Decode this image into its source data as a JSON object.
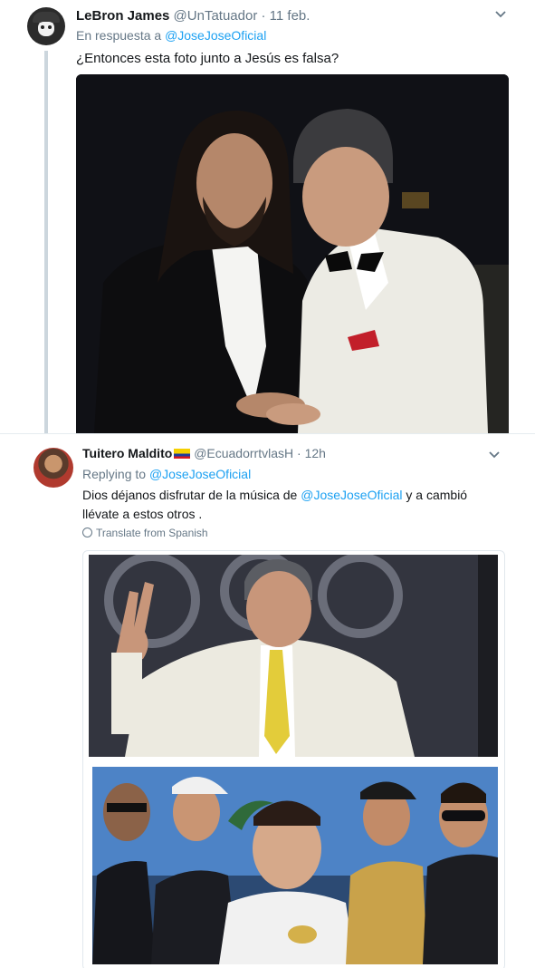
{
  "tweet1": {
    "author_name": "LeBron James",
    "author_handle": "@UnTatuador",
    "date": "11 feb.",
    "reply_prefix": "En respuesta a",
    "reply_to": "@JoseJoseOficial",
    "text": "¿Entonces esta foto junto a Jesús es falsa?"
  },
  "tweet2": {
    "author_name": "Tuitero Maldito",
    "author_handle": "@EcuadorrtvlasH",
    "time": "12h",
    "reply_prefix": "Replying to",
    "reply_to": "@JoseJoseOficial",
    "text_part1": "Dios déjanos disfrutar de la música de",
    "text_mention": "@JoseJoseOficial",
    "text_part2": "y a cambió llévate a estos otros .",
    "translate_label": "Translate from Spanish"
  },
  "separator_dot": "·",
  "colors": {
    "link": "#1da1f2",
    "secondary_text": "#657786",
    "thread_line": "#ccd6dd"
  },
  "icons": {
    "caret": "chevron-down-icon",
    "translate": "globe-icon",
    "flag": "ecuador-flag-icon"
  }
}
